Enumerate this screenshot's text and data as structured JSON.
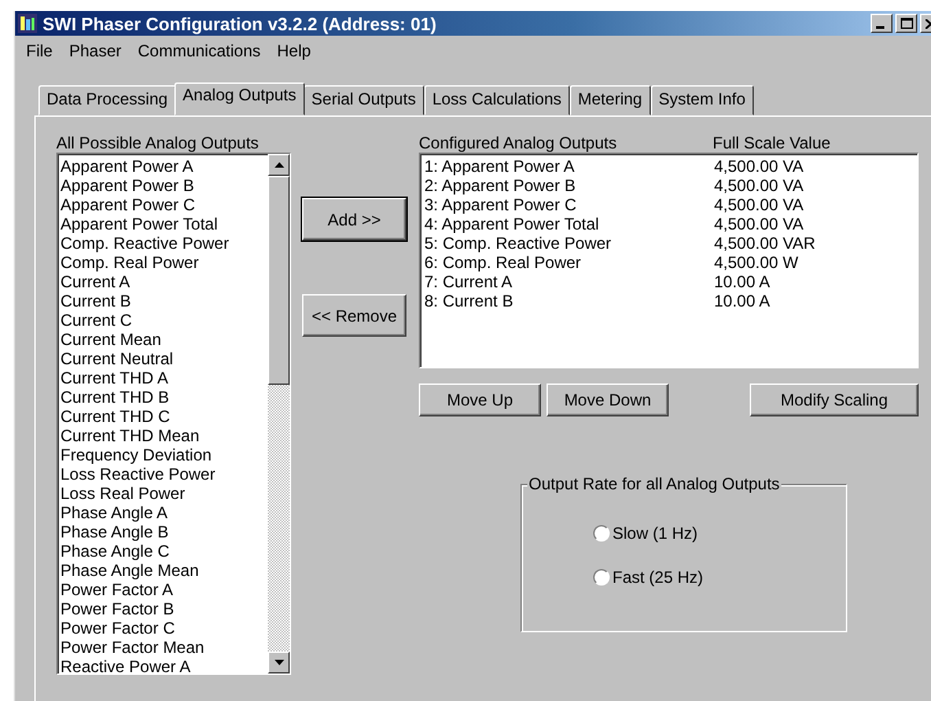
{
  "window": {
    "title": "SWI Phaser Configuration v3.2.2 (Address: 01)"
  },
  "menu": [
    "File",
    "Phaser",
    "Communications",
    "Help"
  ],
  "tabs": [
    {
      "label": "Data Processing",
      "selected": false
    },
    {
      "label": "Analog Outputs",
      "selected": true
    },
    {
      "label": "Serial Outputs",
      "selected": false
    },
    {
      "label": "Loss Calculations",
      "selected": false
    },
    {
      "label": "Metering",
      "selected": false
    },
    {
      "label": "System Info",
      "selected": false
    }
  ],
  "available_outputs": {
    "label": "All Possible Analog Outputs",
    "items": [
      "Apparent Power A",
      "Apparent Power B",
      "Apparent Power C",
      "Apparent Power Total",
      "Comp. Reactive Power",
      "Comp. Real Power",
      "Current A",
      "Current B",
      "Current C",
      "Current Mean",
      "Current Neutral",
      "Current THD A",
      "Current THD B",
      "Current THD C",
      "Current THD Mean",
      "Frequency Deviation",
      "Loss Reactive Power",
      "Loss Real Power",
      "Phase Angle A",
      "Phase Angle B",
      "Phase Angle C",
      "Phase Angle Mean",
      "Power Factor A",
      "Power Factor B",
      "Power Factor C",
      "Power Factor Mean",
      "Reactive Power A"
    ]
  },
  "transfer_buttons": [
    {
      "label": "Add >>",
      "default": true
    },
    {
      "label": "<< Remove",
      "default": false
    }
  ],
  "configured_outputs": {
    "label": "Configured Analog Outputs",
    "value_label": "Full Scale Value",
    "rows": [
      {
        "output": "1: Apparent Power A",
        "full_scale": "4,500.00 VA"
      },
      {
        "output": "2: Apparent Power B",
        "full_scale": "4,500.00 VA"
      },
      {
        "output": "3: Apparent Power C",
        "full_scale": "4,500.00 VA"
      },
      {
        "output": "4: Apparent Power Total",
        "full_scale": "4,500.00 VA"
      },
      {
        "output": "5: Comp. Reactive Power",
        "full_scale": "4,500.00 VAR"
      },
      {
        "output": "6: Comp. Real Power",
        "full_scale": "4,500.00 W"
      },
      {
        "output": "7: Current A",
        "full_scale": "10.00 A"
      },
      {
        "output": "8: Current B",
        "full_scale": "10.00 A"
      }
    ]
  },
  "list_buttons": [
    "Move Up",
    "Move Down",
    "Modify Scaling"
  ],
  "output_rate": {
    "title": "Output Rate for all Analog Outputs",
    "options": [
      {
        "label": "Slow (1 Hz)",
        "selected": false
      },
      {
        "label": "Fast (25 Hz)",
        "selected": false
      }
    ]
  }
}
